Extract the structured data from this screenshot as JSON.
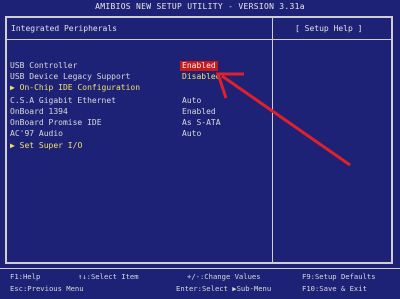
{
  "title": "AMIBIOS NEW SETUP UTILITY - VERSION 3.31a",
  "panel": {
    "left_title": "Integrated Peripherals",
    "right_title": "[ Setup Help ]"
  },
  "items": [
    {
      "label": "USB Controller",
      "value": "Enabled",
      "selected": true
    },
    {
      "label": "USB Device Legacy Support",
      "value": "Disabled",
      "selected": false
    },
    {
      "label": "On-Chip IDE Configuration",
      "value": "",
      "selected": false,
      "submenu": true
    },
    {
      "label": "C.S.A Gigabit Ethernet",
      "value": "Auto",
      "selected": false
    },
    {
      "label": "OnBoard 1394",
      "value": "Enabled",
      "selected": false
    },
    {
      "label": "OnBoard Promise IDE",
      "value": "As S-ATA",
      "selected": false
    },
    {
      "label": "AC'97 Audio",
      "value": "Auto",
      "selected": false
    },
    {
      "label": "Set Super I/O",
      "value": "",
      "selected": false,
      "submenu": true
    }
  ],
  "footer": {
    "row1": [
      "F1:Help",
      "↑↓:Select Item",
      "+/-:Change Values",
      "F9:Setup Defaults"
    ],
    "row2": [
      "Esc:Previous Menu",
      "Enter:Select ▶Sub-Menu",
      "F10:Save & Exit"
    ]
  },
  "colors": {
    "background": "#1e2276",
    "highlight": "#c81818",
    "arrow": "#e0202a",
    "submenu_text": "#f0e06a"
  }
}
